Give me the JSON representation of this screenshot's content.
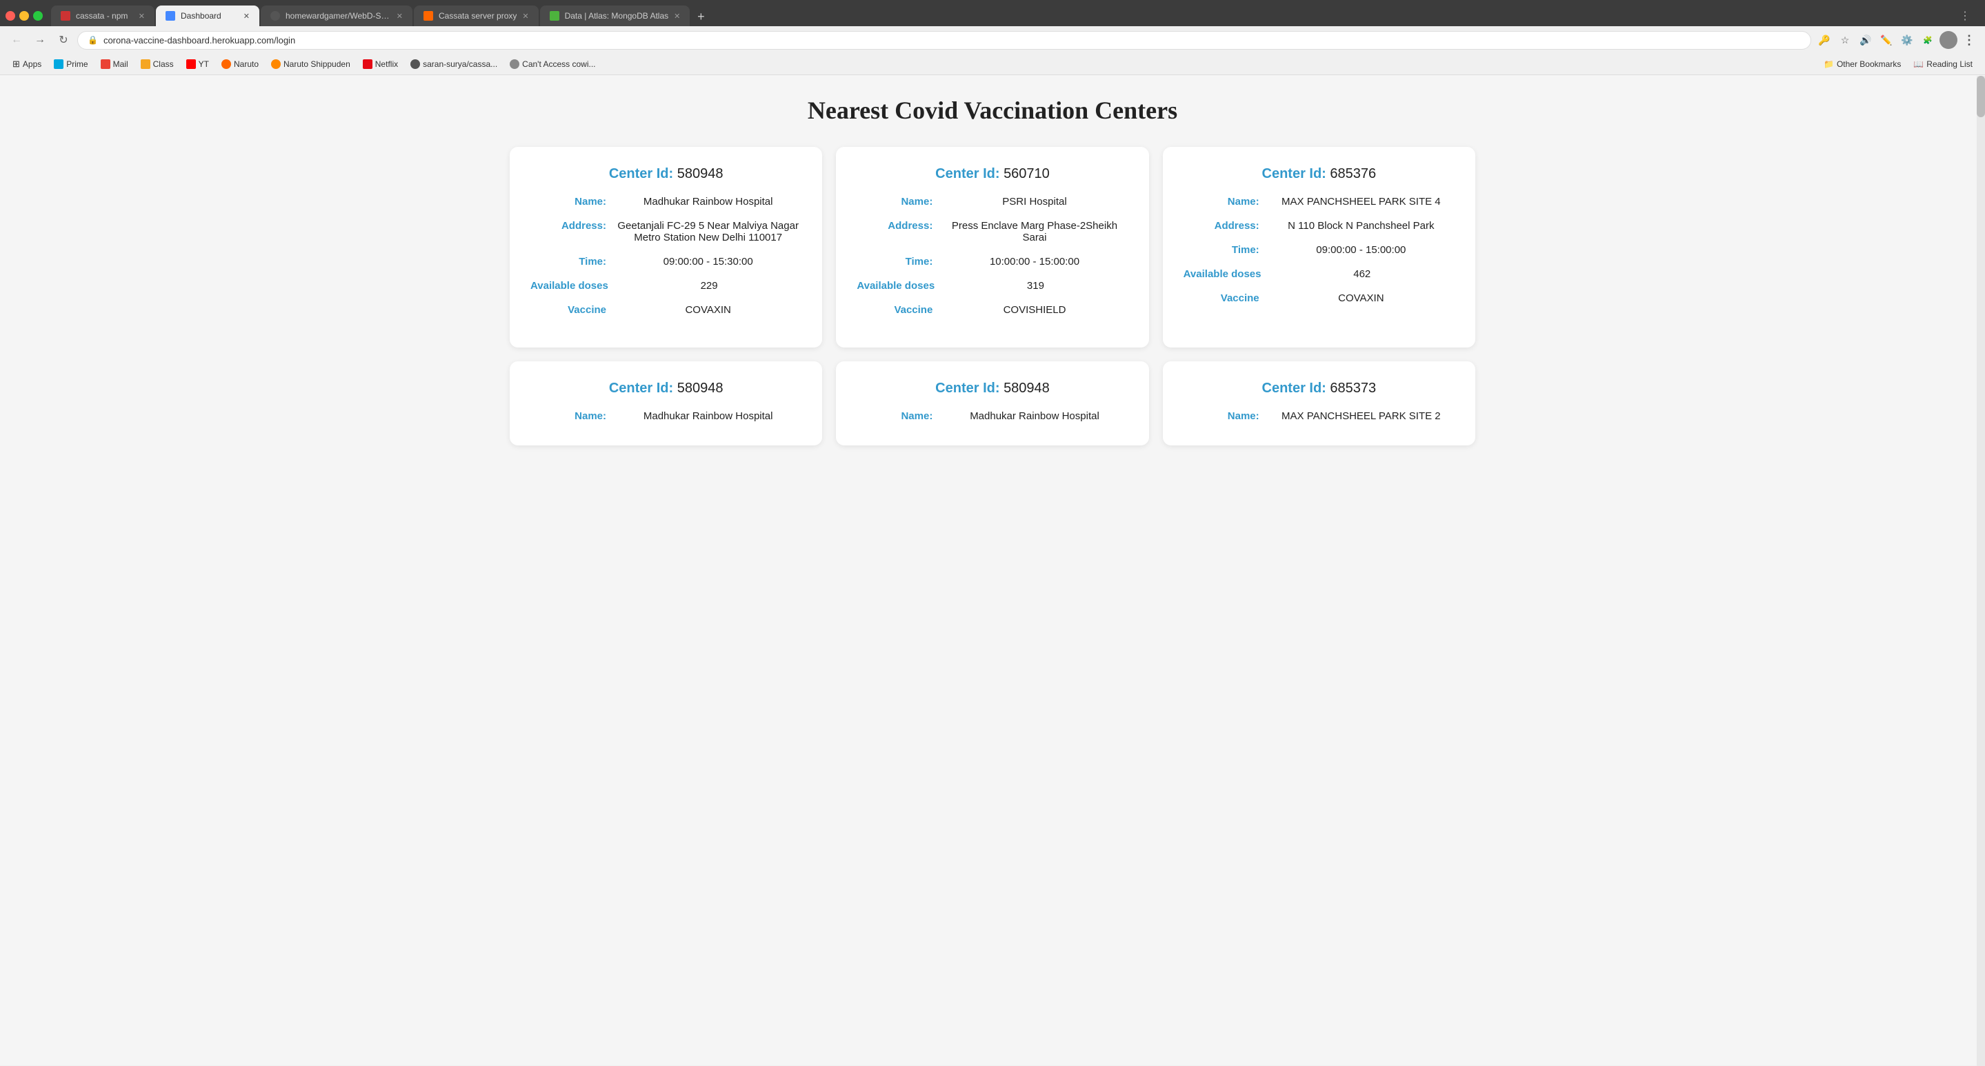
{
  "browser": {
    "tabs": [
      {
        "id": "tab1",
        "label": "cassata - npm",
        "favicon_color": "#cc3333",
        "active": false
      },
      {
        "id": "tab2",
        "label": "Dashboard",
        "favicon_color": "#4488ff",
        "active": true
      },
      {
        "id": "tab3",
        "label": "homewardgamer/WebD-Selec...",
        "favicon_color": "#333",
        "active": false
      },
      {
        "id": "tab4",
        "label": "Cassata server proxy",
        "favicon_color": "#ff6600",
        "active": false
      },
      {
        "id": "tab5",
        "label": "Data | Atlas: MongoDB Atlas",
        "favicon_color": "#4db33d",
        "active": false
      }
    ],
    "address": "corona-vaccine-dashboard.herokuapp.com/login",
    "bookmarks": [
      {
        "id": "apps",
        "label": "Apps",
        "favicon_color": "#4285f4",
        "has_icon": true
      },
      {
        "id": "prime",
        "label": "Prime",
        "favicon_color": "#00a8e0",
        "has_icon": true
      },
      {
        "id": "mail",
        "label": "Mail",
        "favicon_color": "#ea4335",
        "has_icon": true
      },
      {
        "id": "class",
        "label": "Class",
        "favicon_color": "#f5a623",
        "has_icon": true
      },
      {
        "id": "yt",
        "label": "YT",
        "favicon_color": "#ff0000",
        "has_icon": true
      },
      {
        "id": "naruto",
        "label": "Naruto",
        "favicon_color": "#ff6600",
        "has_icon": true
      },
      {
        "id": "naruto-shippuden",
        "label": "Naruto Shippuden",
        "favicon_color": "#ff8800",
        "has_icon": true
      },
      {
        "id": "netflix",
        "label": "Netflix",
        "favicon_color": "#e50914",
        "has_icon": true
      },
      {
        "id": "saran",
        "label": "saran-surya/cassa...",
        "favicon_color": "#333",
        "has_icon": true
      },
      {
        "id": "cantaccess",
        "label": "Can't Access cowi...",
        "favicon_color": "#888",
        "has_icon": true
      }
    ],
    "other_bookmarks_label": "Other Bookmarks",
    "reading_list_label": "Reading List"
  },
  "page": {
    "title": "Nearest Covid Vaccination Centers",
    "accent_color": "#3399cc",
    "cards": [
      {
        "center_id": "580948",
        "name": "Madhukar Rainbow Hospital",
        "address": "Geetanjali FC-29 5 Near Malviya Nagar Metro Station New Delhi 110017",
        "time": "09:00:00 - 15:30:00",
        "available_doses": "229",
        "vaccine": "COVAXIN"
      },
      {
        "center_id": "560710",
        "name": "PSRI Hospital",
        "address": "Press Enclave Marg Phase-2Sheikh Sarai",
        "time": "10:00:00 - 15:00:00",
        "available_doses": "319",
        "vaccine": "COVISHIELD"
      },
      {
        "center_id": "685376",
        "name": "MAX PANCHSHEEL PARK SITE 4",
        "address": "N 110 Block N Panchsheel Park",
        "time": "09:00:00 - 15:00:00",
        "available_doses": "462",
        "vaccine": "COVAXIN"
      },
      {
        "center_id": "580948",
        "name": "Madhukar Rainbow Hospital",
        "address": "",
        "time": "",
        "available_doses": "",
        "vaccine": ""
      },
      {
        "center_id": "580948",
        "name": "Madhukar Rainbow Hospital",
        "address": "",
        "time": "",
        "available_doses": "",
        "vaccine": ""
      },
      {
        "center_id": "685373",
        "name": "MAX PANCHSHEEL PARK SITE 2",
        "address": "",
        "time": "",
        "available_doses": "",
        "vaccine": ""
      }
    ],
    "field_labels": {
      "center_id": "Center Id:",
      "name": "Name:",
      "address": "Address:",
      "time": "Time:",
      "available_doses": "Available doses",
      "vaccine": "Vaccine"
    }
  }
}
